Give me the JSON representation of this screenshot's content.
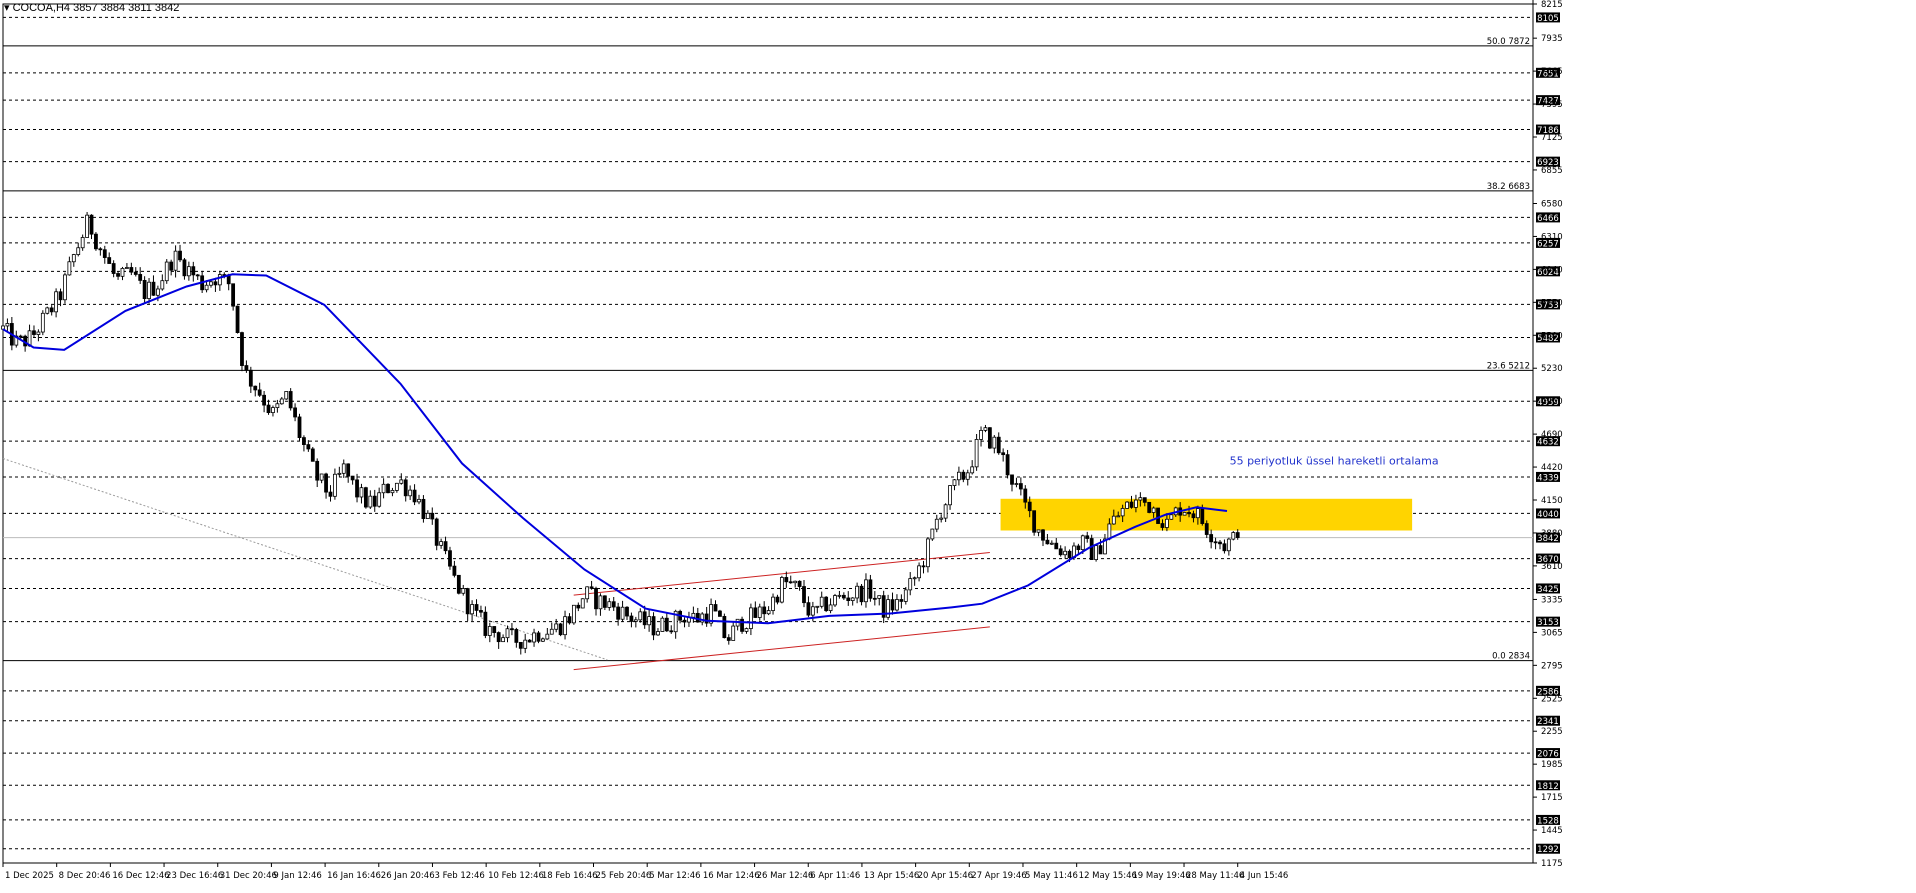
{
  "header": {
    "symbol_label": "COCOA,H4",
    "ohlc_text": "3857 3884 3811 3842"
  },
  "annotation": {
    "ema_label": "55 periyotluk üssel hareketli ortalama"
  },
  "colors": {
    "background": "#ffffff",
    "ema_line": "#0000dd",
    "channel_lines": "#cc2222",
    "zone_fill": "#ffd400",
    "annotation_text": "#2233cc",
    "candle_bull_body": "#ffffff",
    "candle_bear_body": "#000000",
    "gridline": "#000000",
    "trendline": "#999999"
  },
  "chart_data": {
    "type": "candlestick",
    "title": "COCOA,H4",
    "ylim": [
      1175,
      8215
    ],
    "price_axis_ticks": [
      8215,
      7935,
      7665,
      7395,
      7125,
      6855,
      6580,
      6310,
      6040,
      5770,
      5500,
      5230,
      4960,
      4690,
      4420,
      4150,
      3880,
      3610,
      3335,
      3065,
      2795,
      2525,
      2255,
      1985,
      1715,
      1445,
      1175
    ],
    "level_labels": [
      8105,
      7651,
      7427,
      7186,
      6923,
      6466,
      6257,
      6024,
      5753,
      5482,
      4959,
      4632,
      4339,
      4040,
      3670,
      3425,
      3153,
      2586,
      2341,
      2076,
      1812,
      1528,
      1292
    ],
    "current_price": 3842,
    "fibonacci_levels": [
      {
        "label": "50.0 7872",
        "price": 7872
      },
      {
        "label": "38.2 6683",
        "price": 6683
      },
      {
        "label": "23.6 5212",
        "price": 5212
      },
      {
        "label": "0.0 2834",
        "price": 2834
      }
    ],
    "time_labels": [
      "1 Dec 2025",
      "8 Dec 20:46",
      "16 Dec 12:46",
      "23 Dec 16:46",
      "31 Dec 20:46",
      "9 Jan 12:46",
      "16 Jan 16:46",
      "26 Jan 20:46",
      "3 Feb 12:46",
      "10 Feb 12:46",
      "18 Feb 16:46",
      "25 Feb 20:46",
      "5 Mar 12:46",
      "16 Mar 12:46",
      "26 Mar 12:46",
      "6 Apr 11:46",
      "13 Apr 15:46",
      "20 Apr 15:46",
      "27 Apr 19:46",
      "5 May 11:46",
      "12 May 15:46",
      "19 May 19:46",
      "28 May 11:46",
      "4 Jun 15:46"
    ],
    "price_path": [
      5550,
      5430,
      5480,
      5650,
      5820,
      6150,
      6430,
      6180,
      5950,
      6000,
      5850,
      5930,
      6150,
      6050,
      5920,
      5980,
      5920,
      5200,
      5050,
      4850,
      5000,
      4650,
      4350,
      4200,
      4400,
      4200,
      4100,
      4250,
      4300,
      4200,
      3980,
      3700,
      3450,
      3250,
      3100,
      3050,
      3000,
      3020,
      3080,
      3100,
      3200,
      3380,
      3320,
      3280,
      3200,
      3150,
      3100,
      3150,
      3200,
      3180,
      3250,
      3000,
      3150,
      3200,
      3280,
      3480,
      3420,
      3200,
      3300,
      3350,
      3380,
      3420,
      3250,
      3300,
      3450,
      3700,
      4050,
      4250,
      4400,
      4700,
      4600,
      4350,
      4100,
      3900,
      3780,
      3720,
      3800,
      3700,
      3950,
      4080,
      4150,
      4100,
      3950,
      4100,
      4050,
      3900,
      3780,
      3842
    ],
    "ema_55": [
      {
        "t": 0.0,
        "p": 5550
      },
      {
        "t": 0.02,
        "p": 5400
      },
      {
        "t": 0.04,
        "p": 5380
      },
      {
        "t": 0.08,
        "p": 5700
      },
      {
        "t": 0.12,
        "p": 5900
      },
      {
        "t": 0.15,
        "p": 6000
      },
      {
        "t": 0.172,
        "p": 5990
      },
      {
        "t": 0.21,
        "p": 5750
      },
      {
        "t": 0.26,
        "p": 5100
      },
      {
        "t": 0.3,
        "p": 4450
      },
      {
        "t": 0.34,
        "p": 4000
      },
      {
        "t": 0.38,
        "p": 3580
      },
      {
        "t": 0.42,
        "p": 3260
      },
      {
        "t": 0.46,
        "p": 3160
      },
      {
        "t": 0.5,
        "p": 3140
      },
      {
        "t": 0.54,
        "p": 3200
      },
      {
        "t": 0.58,
        "p": 3220
      },
      {
        "t": 0.62,
        "p": 3270
      },
      {
        "t": 0.64,
        "p": 3300
      },
      {
        "t": 0.67,
        "p": 3450
      },
      {
        "t": 0.71,
        "p": 3760
      },
      {
        "t": 0.74,
        "p": 3930
      },
      {
        "t": 0.76,
        "p": 4030
      },
      {
        "t": 0.78,
        "p": 4090
      },
      {
        "t": 0.8,
        "p": 4060
      }
    ],
    "rising_channel": [
      {
        "t0": 0.373,
        "p0": 3370,
        "t1": 0.645,
        "p1": 3720
      },
      {
        "t0": 0.373,
        "p0": 2760,
        "t1": 0.645,
        "p1": 3110
      }
    ],
    "trendline": {
      "t0": 0.0,
      "p0": 4490,
      "t1": 0.395,
      "p1": 2840
    },
    "resistance_zone": {
      "t0": 0.652,
      "t1": 0.921,
      "p_low": 3900,
      "p_high": 4160
    }
  }
}
